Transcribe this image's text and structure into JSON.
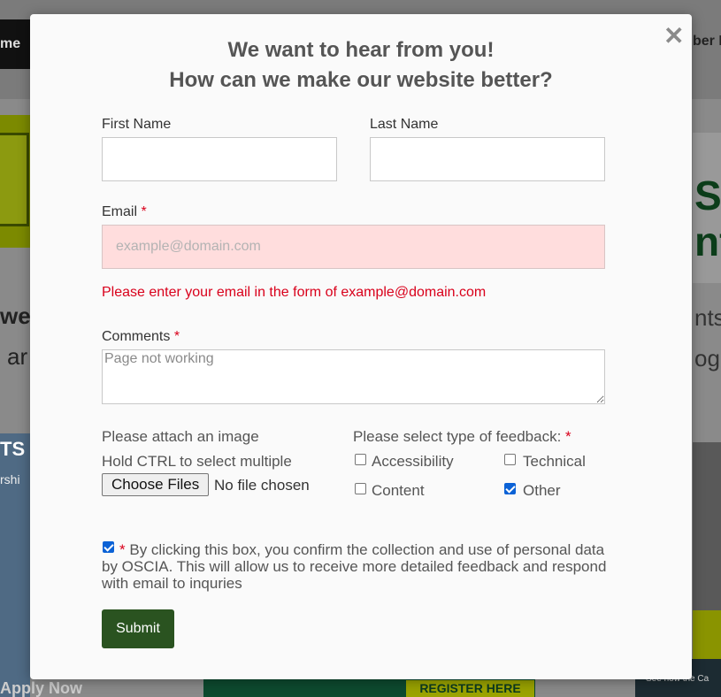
{
  "background": {
    "nav_left": "me",
    "nav_right": "ber L",
    "text_left_1": "we",
    "text_left_2": "ar",
    "text_right_1": "nts",
    "text_right_2": "og",
    "right_big": "S\nnt",
    "photo_label": "TS",
    "photo_sub": "rshi",
    "photo_bottom": "Apply Now",
    "register": "REGISTER HERE",
    "right_ad_text": "See how the Ca"
  },
  "modal": {
    "close_glyph": "✕",
    "title_line1": "We want to hear from you!",
    "title_line2": "How can we make our website better?",
    "first_name_label": "First Name",
    "first_name_value": "",
    "last_name_label": "Last Name",
    "last_name_value": "",
    "email_label": "Email",
    "email_placeholder": "example@domain.com",
    "email_error": "Please enter your email in the form of example@domain.com",
    "comments_label": "Comments",
    "comments_value": "Page not working",
    "required_mark": "*",
    "attach_label": "Please attach an image",
    "attach_hint": "Hold CTRL to select multiple",
    "choose_files": "Choose Files",
    "no_file": "No file chosen",
    "feedback_label": "Please select type of feedback:",
    "feedback_options": [
      {
        "label": "Accessibility",
        "checked": false
      },
      {
        "label": "Technical",
        "checked": false
      },
      {
        "label": "Content",
        "checked": false
      },
      {
        "label": "Other",
        "checked": true
      }
    ],
    "consent_checked": true,
    "consent_text": "By clicking this box, you confirm the collection and use of personal data by OSCIA. This will allow us to receive more detailed feedback and respond with email to inquries",
    "submit_label": "Submit"
  },
  "colors": {
    "submit_bg": "#2a5320",
    "error": "#d9001b",
    "email_error_bg": "#ffdddd",
    "checkbox_blue": "#0b62d6"
  }
}
